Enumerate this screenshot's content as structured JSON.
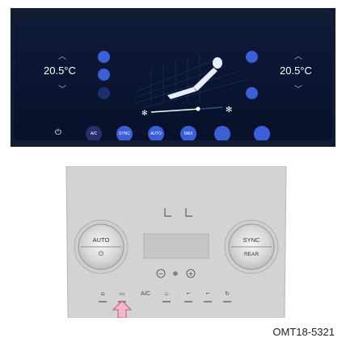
{
  "screen": {
    "temp_left": "20.5°C",
    "temp_right": "20.5°C",
    "up_glyph": "︿",
    "down_glyph": "﹀",
    "power_glyph": "⏻",
    "handle_glyph": "︿",
    "buttons": [
      "A/C",
      "SYNC",
      "AUTO",
      "MAX",
      "",
      ""
    ],
    "fan_level": 0.4,
    "accent": "#3b5fd7"
  },
  "panel": {
    "left_knob": {
      "top": "AUTO",
      "bottom": "⏻"
    },
    "right_knob": {
      "top": "SYNC",
      "bottom": "REAR"
    },
    "ac_label": "A/C",
    "minus": "−",
    "plus": "+"
  },
  "caption": "OMT18-5321"
}
